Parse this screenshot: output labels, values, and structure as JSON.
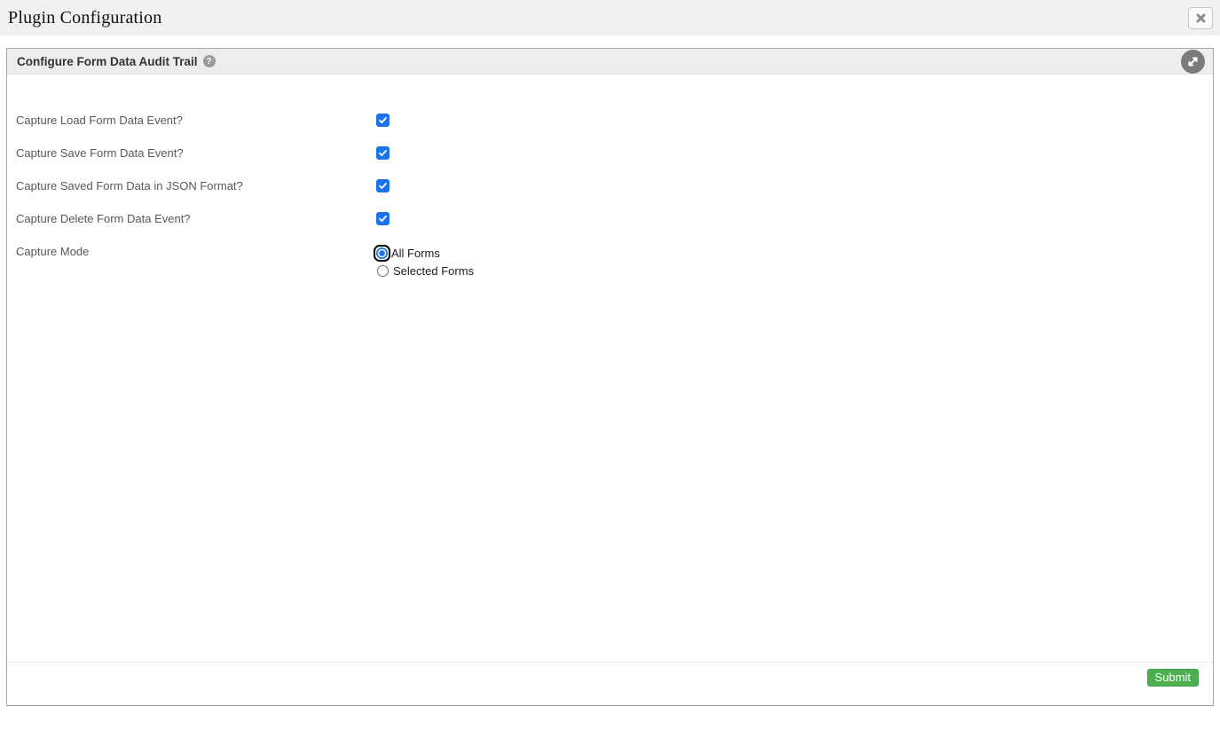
{
  "window": {
    "title": "Plugin Configuration"
  },
  "panel": {
    "title": "Configure Form Data Audit Trail",
    "help_glyph": "?",
    "submit_label": "Submit"
  },
  "form": {
    "checkboxes": [
      {
        "label": "Capture Load Form Data Event?",
        "checked": true
      },
      {
        "label": "Capture Save Form Data Event?",
        "checked": true
      },
      {
        "label": "Capture Saved Form Data in JSON Format?",
        "checked": true
      },
      {
        "label": "Capture Delete Form Data Event?",
        "checked": true
      }
    ],
    "capture_mode": {
      "label": "Capture Mode",
      "options": [
        {
          "label": "All Forms",
          "selected": true,
          "focused": true
        },
        {
          "label": "Selected Forms",
          "selected": false,
          "focused": false
        }
      ]
    }
  },
  "colors": {
    "accent_blue": "#1a73e8",
    "submit_green": "#4caf50",
    "header_gray": "#ededed",
    "titlebar_gray": "#f0f0ee"
  }
}
